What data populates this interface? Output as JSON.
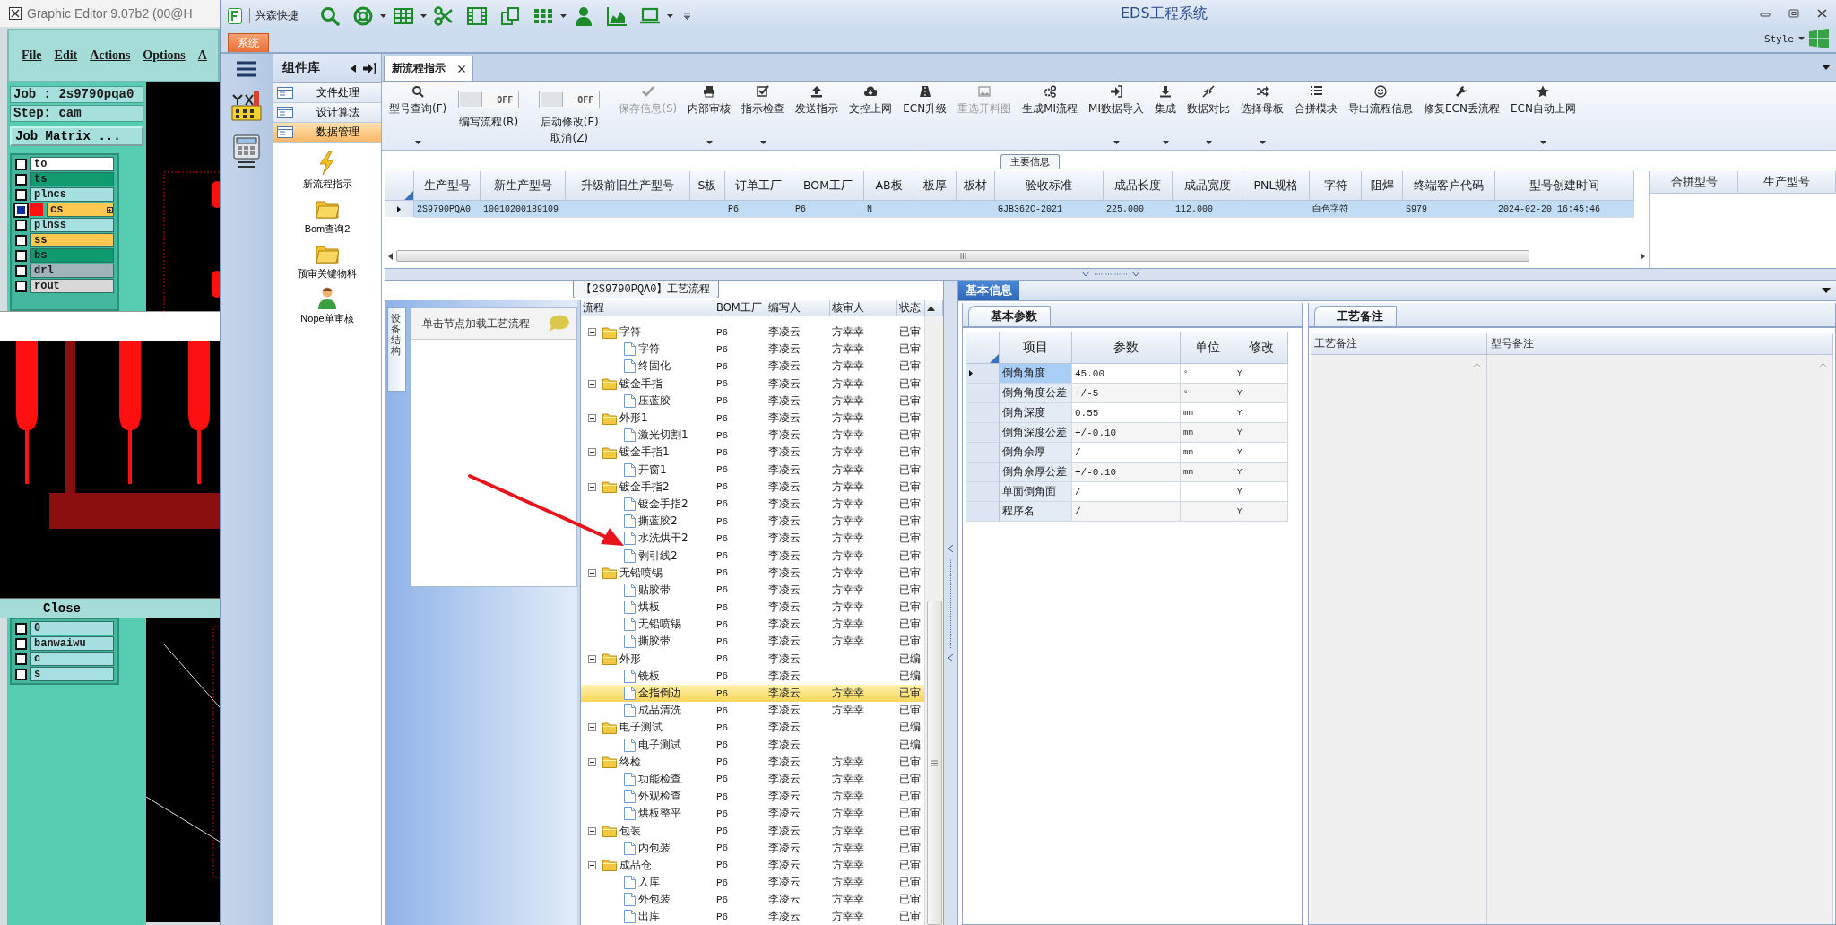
{
  "graphic_editor": {
    "title": "Graphic Editor 9.07b2 (00@H",
    "menu": [
      "File",
      "Edit",
      "Actions",
      "Options",
      "A"
    ],
    "job": "Job : 2s9790pqa0",
    "step": "Step: cam",
    "job_matrix_button": "Job Matrix ...",
    "layers_top": [
      {
        "name": "to",
        "color": "#ffffff",
        "selected": false
      },
      {
        "name": "ts",
        "color": "#109a70",
        "selected": false
      },
      {
        "name": "plncs",
        "color": "#a6e0e0",
        "selected": false
      },
      {
        "name": "cs",
        "color": "#ffc850",
        "selected": true
      },
      {
        "name": "plnss",
        "color": "#a6e0e0",
        "selected": false
      },
      {
        "name": "ss",
        "color": "#ffc850",
        "selected": false
      },
      {
        "name": "bs",
        "color": "#109a70",
        "selected": false
      },
      {
        "name": "drl",
        "color": "#9fb3b8",
        "selected": false
      },
      {
        "name": "rout",
        "color": "#d8d8d8",
        "selected": false
      }
    ],
    "close_button": "Close",
    "layers_bottom": [
      {
        "name": "0",
        "color": "#a6e0e0",
        "selected": false
      },
      {
        "name": "banwaiwu",
        "color": "#a6e0e0",
        "selected": false
      },
      {
        "name": "c",
        "color": "#a6e0e0",
        "selected": false
      },
      {
        "name": "s",
        "color": "#a6e0e0",
        "selected": false
      }
    ]
  },
  "window": {
    "title": "EDS工程系统",
    "company": "兴森快捷"
  },
  "quick_access": [
    {
      "has_menu": false
    },
    {
      "has_menu": true
    },
    {
      "has_menu": true
    },
    {
      "has_menu": false
    },
    {
      "has_menu": false
    },
    {
      "has_menu": false
    },
    {
      "has_menu": true
    },
    {
      "has_menu": false
    },
    {
      "has_menu": false
    },
    {
      "has_menu": true
    }
  ],
  "system_tab": {
    "label": "系统",
    "selected": true
  },
  "style_menu": "Style",
  "component_panel": {
    "title": "组件库",
    "categories": [
      {
        "label": "文件处理",
        "selected": false
      },
      {
        "label": "设计算法",
        "selected": false
      },
      {
        "label": "数据管理",
        "selected": true
      }
    ],
    "tools": [
      {
        "kind": "lightning",
        "label": "新流程指示"
      },
      {
        "kind": "folder",
        "label": "Bom查询2"
      },
      {
        "kind": "folder",
        "label": "预审关键物料"
      },
      {
        "kind": "user",
        "label": "Nope单审核"
      }
    ]
  },
  "document_tabs": [
    {
      "label": "新流程指示",
      "selected": true
    }
  ],
  "ribbon": [
    {
      "kind": "button",
      "label": "型号查询(F)",
      "disabled": false,
      "has_menu": true
    },
    {
      "kind": "toggle",
      "label": "编写流程(R)",
      "on": false,
      "state_text": "OFF"
    },
    {
      "kind": "toggle",
      "label": "启动修改(E) 取消(Z)",
      "on": false,
      "state_text": "OFF"
    },
    {
      "kind": "button",
      "label": "保存信息(S)",
      "disabled": true,
      "has_menu": false
    },
    {
      "kind": "button",
      "label": "内部审核",
      "disabled": false,
      "has_menu": true
    },
    {
      "kind": "button",
      "label": "指示检查",
      "disabled": false,
      "has_menu": true
    },
    {
      "kind": "button",
      "label": "发送指示",
      "disabled": false,
      "has_menu": false
    },
    {
      "kind": "button",
      "label": "文控上网",
      "disabled": false,
      "has_menu": false
    },
    {
      "kind": "button",
      "label": "ECN升级",
      "disabled": false,
      "has_menu": false
    },
    {
      "kind": "button",
      "label": "重选开料图",
      "disabled": true,
      "has_menu": false
    },
    {
      "kind": "button",
      "label": "生成MI流程",
      "disabled": false,
      "has_menu": false
    },
    {
      "kind": "button",
      "label": "MI数据导入",
      "disabled": false,
      "has_menu": true
    },
    {
      "kind": "button",
      "label": "集成",
      "disabled": false,
      "has_menu": true
    },
    {
      "kind": "button",
      "label": "数据对比",
      "disabled": false,
      "has_menu": true
    },
    {
      "kind": "button",
      "label": "选择母板",
      "disabled": false,
      "has_menu": true
    },
    {
      "kind": "button",
      "label": "合拼模块",
      "disabled": false,
      "has_menu": false
    },
    {
      "kind": "button",
      "label": "导出流程信息",
      "disabled": false,
      "has_menu": false
    },
    {
      "kind": "button",
      "label": "修复ECN丢流程",
      "disabled": false,
      "has_menu": false
    },
    {
      "kind": "button",
      "label": "ECN自动上网",
      "disabled": false,
      "has_menu": true
    }
  ],
  "main_info": {
    "title": "主要信息",
    "columns": [
      "生产型号",
      "新生产型号",
      "升级前旧生产型号",
      "S板",
      "订单工厂",
      "BOM工厂",
      "AB板",
      "板厚",
      "板材",
      "验收标准",
      "成品长度",
      "成品宽度",
      "PNL规格",
      "字符",
      "阻焊",
      "终端客户代码",
      "型号创建时间"
    ],
    "rows": [
      {
        "selected": true,
        "cells": [
          "2S9790PQA0",
          "10010200189109",
          null,
          null,
          "P6",
          "P6",
          "N",
          null,
          null,
          "GJB362C-2021",
          "225.000",
          "112.000",
          null,
          "白色字符",
          null,
          "S979",
          "2024-02-20 16:45:46"
        ]
      }
    ],
    "merge_columns": [
      "合拼型号",
      "生产型号"
    ]
  },
  "process": {
    "title": "【2S9790PQA0】工艺流程",
    "side_tab": "设备结构",
    "hint": "单击节点加载工艺流程",
    "columns": [
      "流程",
      "BOM工厂",
      "编写人",
      "核审人",
      "状态"
    ],
    "tree": [
      {
        "label": "字符",
        "bom": "P6",
        "writer": "李凌云",
        "reviewer": "方幸幸",
        "status": "已审",
        "expanded": true,
        "selected": false,
        "children": [
          {
            "label": "字符",
            "bom": "P6",
            "writer": "李凌云",
            "reviewer": "方幸幸",
            "status": "已审",
            "selected": false
          },
          {
            "label": "终固化",
            "bom": "P6",
            "writer": "李凌云",
            "reviewer": "方幸幸",
            "status": "已审",
            "selected": false
          }
        ]
      },
      {
        "label": "镀金手指",
        "bom": "P6",
        "writer": "李凌云",
        "reviewer": "方幸幸",
        "status": "已审",
        "expanded": true,
        "selected": false,
        "children": [
          {
            "label": "压蓝胶",
            "bom": "P6",
            "writer": "李凌云",
            "reviewer": "方幸幸",
            "status": "已审",
            "selected": false
          }
        ]
      },
      {
        "label": "外形1",
        "bom": "P6",
        "writer": "李凌云",
        "reviewer": "方幸幸",
        "status": "已审",
        "expanded": true,
        "selected": false,
        "children": [
          {
            "label": "激光切割1",
            "bom": "P6",
            "writer": "李凌云",
            "reviewer": "方幸幸",
            "status": "已审",
            "selected": false
          }
        ]
      },
      {
        "label": "镀金手指1",
        "bom": "P6",
        "writer": "李凌云",
        "reviewer": "方幸幸",
        "status": "已审",
        "expanded": true,
        "selected": false,
        "children": [
          {
            "label": "开窗1",
            "bom": "P6",
            "writer": "李凌云",
            "reviewer": "方幸幸",
            "status": "已审",
            "selected": false
          }
        ]
      },
      {
        "label": "镀金手指2",
        "bom": "P6",
        "writer": "李凌云",
        "reviewer": "方幸幸",
        "status": "已审",
        "expanded": true,
        "selected": false,
        "children": [
          {
            "label": "镀金手指2",
            "bom": "P6",
            "writer": "李凌云",
            "reviewer": "方幸幸",
            "status": "已审",
            "selected": false
          },
          {
            "label": "撕蓝胶2",
            "bom": "P6",
            "writer": "李凌云",
            "reviewer": "方幸幸",
            "status": "已审",
            "selected": false
          },
          {
            "label": "水洗烘干2",
            "bom": "P6",
            "writer": "李凌云",
            "reviewer": "方幸幸",
            "status": "已审",
            "selected": false
          },
          {
            "label": "剥引线2",
            "bom": "P6",
            "writer": "李凌云",
            "reviewer": "方幸幸",
            "status": "已审",
            "selected": false
          }
        ]
      },
      {
        "label": "无铅喷锡",
        "bom": "P6",
        "writer": "李凌云",
        "reviewer": "方幸幸",
        "status": "已审",
        "expanded": true,
        "selected": false,
        "children": [
          {
            "label": "贴胶带",
            "bom": "P6",
            "writer": "李凌云",
            "reviewer": "方幸幸",
            "status": "已审",
            "selected": false
          },
          {
            "label": "烘板",
            "bom": "P6",
            "writer": "李凌云",
            "reviewer": "方幸幸",
            "status": "已审",
            "selected": false
          },
          {
            "label": "无铅喷锡",
            "bom": "P6",
            "writer": "李凌云",
            "reviewer": "方幸幸",
            "status": "已审",
            "selected": false
          },
          {
            "label": "撕胶带",
            "bom": "P6",
            "writer": "李凌云",
            "reviewer": "方幸幸",
            "status": "已审",
            "selected": false
          }
        ]
      },
      {
        "label": "外形",
        "bom": "P6",
        "writer": "李凌云",
        "status": "已编",
        "expanded": true,
        "selected": false,
        "children": [
          {
            "label": "铣板",
            "bom": "P6",
            "writer": "李凌云",
            "status": "已编",
            "selected": false
          },
          {
            "label": "金指倒边",
            "bom": "P6",
            "writer": "李凌云",
            "reviewer": "方幸幸",
            "status": "已审",
            "selected": true
          },
          {
            "label": "成品清洗",
            "bom": "P6",
            "writer": "李凌云",
            "reviewer": "方幸幸",
            "status": "已审",
            "selected": false
          }
        ]
      },
      {
        "label": "电子测试",
        "bom": "P6",
        "writer": "李凌云",
        "status": "已编",
        "expanded": true,
        "selected": false,
        "children": [
          {
            "label": "电子测试",
            "bom": "P6",
            "writer": "李凌云",
            "status": "已编",
            "selected": false
          }
        ]
      },
      {
        "label": "终检",
        "bom": "P6",
        "writer": "李凌云",
        "reviewer": "方幸幸",
        "status": "已审",
        "expanded": true,
        "selected": false,
        "children": [
          {
            "label": "功能检查",
            "bom": "P6",
            "writer": "李凌云",
            "reviewer": "方幸幸",
            "status": "已审",
            "selected": false
          },
          {
            "label": "外观检查",
            "bom": "P6",
            "writer": "李凌云",
            "reviewer": "方幸幸",
            "status": "已审",
            "selected": false
          },
          {
            "label": "烘板整平",
            "bom": "P6",
            "writer": "李凌云",
            "reviewer": "方幸幸",
            "status": "已审",
            "selected": false
          }
        ]
      },
      {
        "label": "包装",
        "bom": "P6",
        "writer": "李凌云",
        "reviewer": "方幸幸",
        "status": "已审",
        "expanded": true,
        "selected": false,
        "children": [
          {
            "label": "内包装",
            "bom": "P6",
            "writer": "李凌云",
            "reviewer": "方幸幸",
            "status": "已审",
            "selected": false
          }
        ]
      },
      {
        "label": "成品仓",
        "bom": "P6",
        "writer": "李凌云",
        "reviewer": "方幸幸",
        "status": "已审",
        "expanded": true,
        "selected": false,
        "children": [
          {
            "label": "入库",
            "bom": "P6",
            "writer": "李凌云",
            "reviewer": "方幸幸",
            "status": "已审",
            "selected": false
          },
          {
            "label": "外包装",
            "bom": "P6",
            "writer": "李凌云",
            "reviewer": "方幸幸",
            "status": "已审",
            "selected": false
          },
          {
            "label": "出库",
            "bom": "P6",
            "writer": "李凌云",
            "reviewer": "方幸幸",
            "status": "已审",
            "selected": false
          }
        ]
      }
    ]
  },
  "basic_info": {
    "tab": "基本信息",
    "params_tab": "基本参数",
    "columns": [
      "项目",
      "参数",
      "单位",
      "修改"
    ],
    "rows": [
      {
        "item": "倒角角度",
        "value": "45.00",
        "unit": "°",
        "modified": "Y",
        "selected": true
      },
      {
        "item": "倒角角度公差",
        "value": "+/-5",
        "unit": "°",
        "modified": "Y",
        "selected": false
      },
      {
        "item": "倒角深度",
        "value": "0.55",
        "unit": "mm",
        "modified": "Y",
        "selected": false
      },
      {
        "item": "倒角深度公差",
        "value": "+/-0.10",
        "unit": "mm",
        "modified": "Y",
        "selected": false
      },
      {
        "item": "倒角余厚",
        "value": "/",
        "unit": "mm",
        "modified": "Y",
        "selected": false
      },
      {
        "item": "倒角余厚公差",
        "value": "+/-0.10",
        "unit": "mm",
        "modified": "Y",
        "selected": false
      },
      {
        "item": "单面倒角面",
        "value": "/",
        "modified": "Y",
        "selected": false
      },
      {
        "item": "程序名",
        "value": "/",
        "modified": "Y",
        "selected": false
      }
    ]
  },
  "notes": {
    "tab": "工艺备注",
    "columns": [
      "工艺备注",
      "型号备注"
    ]
  },
  "annotations": [
    {
      "kind": "arrow"
    }
  ]
}
